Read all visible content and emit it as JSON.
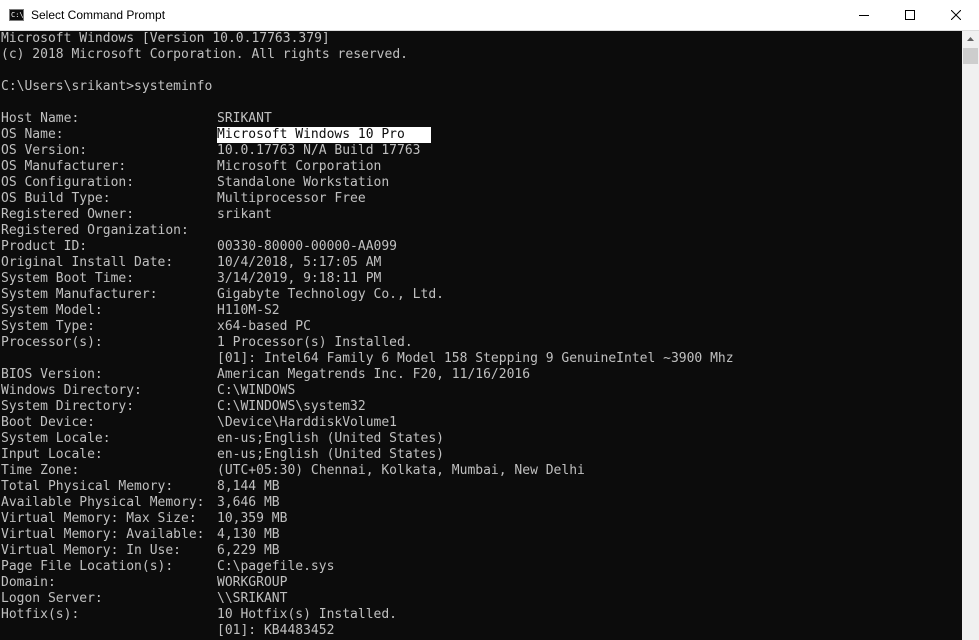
{
  "window": {
    "title": "Select Command Prompt",
    "icon_text": "C:\\",
    "controls": {
      "minimize": "minimize-icon",
      "maximize": "maximize-icon",
      "close": "close-icon"
    }
  },
  "console": {
    "banner": [
      "Microsoft Windows [Version 10.0.17763.379]",
      "(c) 2018 Microsoft Corporation. All rights reserved."
    ],
    "prompt": "C:\\Users\\srikant>systeminfo",
    "rows": [
      {
        "key": "Host Name:",
        "value": "SRIKANT"
      },
      {
        "key": "OS Name:",
        "value": "Microsoft Windows 10 Pro"
      },
      {
        "key": "OS Version:",
        "value": "10.0.17763 N/A Build 17763"
      },
      {
        "key": "OS Manufacturer:",
        "value": "Microsoft Corporation"
      },
      {
        "key": "OS Configuration:",
        "value": "Standalone Workstation"
      },
      {
        "key": "OS Build Type:",
        "value": "Multiprocessor Free"
      },
      {
        "key": "Registered Owner:",
        "value": "srikant"
      },
      {
        "key": "Registered Organization:",
        "value": ""
      },
      {
        "key": "Product ID:",
        "value": "00330-80000-00000-AA099"
      },
      {
        "key": "Original Install Date:",
        "value": "10/4/2018, 5:17:05 AM"
      },
      {
        "key": "System Boot Time:",
        "value": "3/14/2019, 9:18:11 PM"
      },
      {
        "key": "System Manufacturer:",
        "value": "Gigabyte Technology Co., Ltd."
      },
      {
        "key": "System Model:",
        "value": "H110M-S2"
      },
      {
        "key": "System Type:",
        "value": "x64-based PC"
      },
      {
        "key": "Processor(s):",
        "value": "1 Processor(s) Installed."
      },
      {
        "key": "",
        "value": "[01]: Intel64 Family 6 Model 158 Stepping 9 GenuineIntel ~3900 Mhz"
      },
      {
        "key": "BIOS Version:",
        "value": "American Megatrends Inc. F20, 11/16/2016"
      },
      {
        "key": "Windows Directory:",
        "value": "C:\\WINDOWS"
      },
      {
        "key": "System Directory:",
        "value": "C:\\WINDOWS\\system32"
      },
      {
        "key": "Boot Device:",
        "value": "\\Device\\HarddiskVolume1"
      },
      {
        "key": "System Locale:",
        "value": "en-us;English (United States)"
      },
      {
        "key": "Input Locale:",
        "value": "en-us;English (United States)"
      },
      {
        "key": "Time Zone:",
        "value": "(UTC+05:30) Chennai, Kolkata, Mumbai, New Delhi"
      },
      {
        "key": "Total Physical Memory:",
        "value": "8,144 MB"
      },
      {
        "key": "Available Physical Memory:",
        "value": "3,646 MB"
      },
      {
        "key": "Virtual Memory: Max Size:",
        "value": "10,359 MB"
      },
      {
        "key": "Virtual Memory: Available:",
        "value": "4,130 MB"
      },
      {
        "key": "Virtual Memory: In Use:",
        "value": "6,229 MB"
      },
      {
        "key": "Page File Location(s):",
        "value": "C:\\pagefile.sys"
      },
      {
        "key": "Domain:",
        "value": "WORKGROUP"
      },
      {
        "key": "Logon Server:",
        "value": "\\\\SRIKANT"
      },
      {
        "key": "Hotfix(s):",
        "value": "10 Hotfix(s) Installed."
      },
      {
        "key": "",
        "value": "[01]: KB4483452"
      }
    ],
    "selected_value": "Microsoft Windows 10 Pro"
  },
  "scrollbar": {
    "up_arrow": "scroll-up-arrow-icon"
  },
  "colors": {
    "console_bg": "#0c0c0c",
    "console_fg": "#c0c0c0",
    "selection_bg": "#ffffff",
    "titlebar_bg": "#ffffff"
  }
}
